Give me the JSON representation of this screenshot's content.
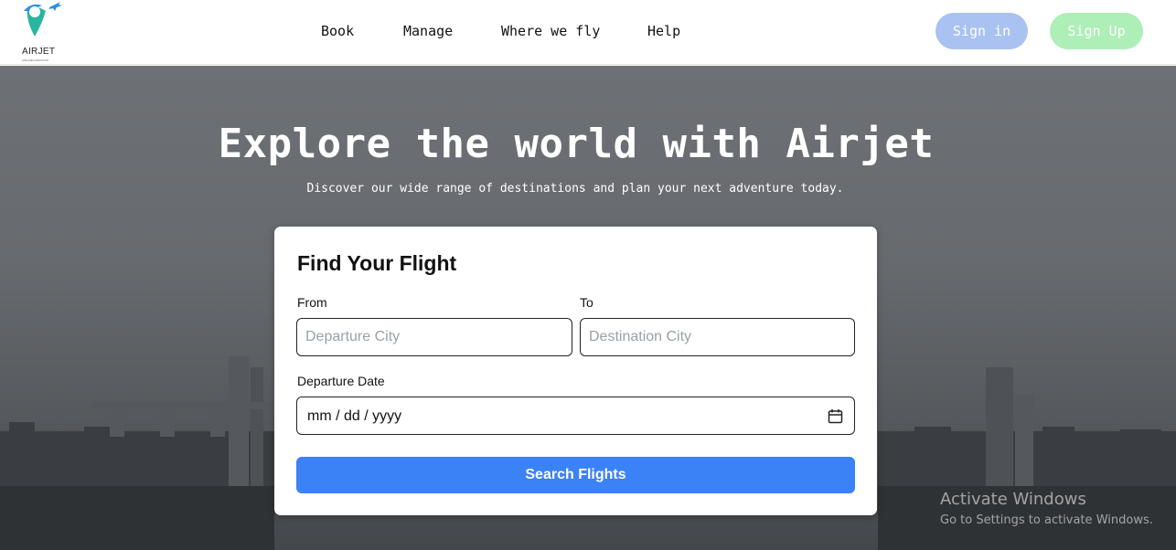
{
  "brand": {
    "name": "AIRJET",
    "tagline": "AIRLINES PAKISTAN",
    "accent": "#2bb5a0",
    "plane_color": "#2f8fe0"
  },
  "nav": {
    "book": "Book",
    "manage": "Manage",
    "where": "Where we fly",
    "help": "Help"
  },
  "auth": {
    "signin": "Sign in",
    "signup": "Sign Up",
    "signin_color": "#a9c2f1",
    "signup_color": "#aeeeb7"
  },
  "hero": {
    "title": "Explore the world with Airjet",
    "subtitle": "Discover our wide range of destinations and plan your next adventure today."
  },
  "form": {
    "title": "Find Your Flight",
    "from_label": "From",
    "from_placeholder": "Departure City",
    "to_label": "To",
    "to_placeholder": "Destination City",
    "date_label": "Departure Date",
    "date_value": "mm / dd / yyyy",
    "search_label": "Search Flights",
    "search_color": "#3b82f6"
  },
  "watermark": {
    "title": "Activate Windows",
    "subtitle": "Go to Settings to activate Windows."
  }
}
